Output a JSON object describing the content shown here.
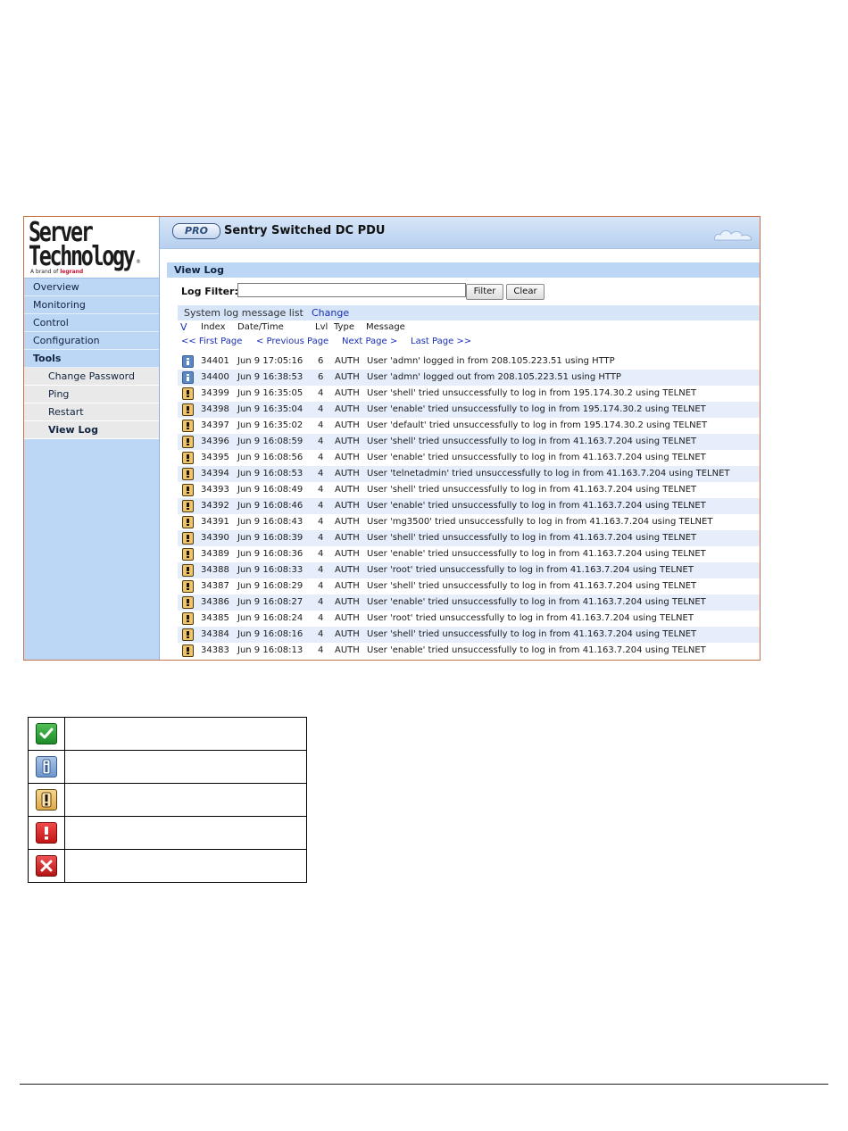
{
  "app": {
    "logo_line1": "Server",
    "logo_line2": "Technology",
    "logo_reg": "®",
    "brand_prefix": "A brand of",
    "brand_name": "legrand",
    "pro_badge": "PRO",
    "product_title": "Sentry Switched DC PDU"
  },
  "sidebar": {
    "items": [
      {
        "label": "Overview"
      },
      {
        "label": "Monitoring"
      },
      {
        "label": "Control"
      },
      {
        "label": "Configuration"
      },
      {
        "label": "Tools"
      }
    ],
    "tools_sub": [
      {
        "label": "Change Password"
      },
      {
        "label": "Ping"
      },
      {
        "label": "Restart"
      },
      {
        "label": "View Log"
      }
    ]
  },
  "section_title": "View Log",
  "filter": {
    "label": "Log Filter:",
    "value": "",
    "filter_button": "Filter",
    "clear_button": "Clear"
  },
  "list": {
    "title": "System log message list",
    "change_link": "Change",
    "sort_glyph": "V",
    "columns": {
      "index": "Index",
      "datetime": "Date/Time",
      "lvl": "Lvl",
      "type": "Type",
      "message": "Message"
    },
    "pager": {
      "first": "<< First Page",
      "prev": "< Previous Page",
      "next": "Next Page >",
      "last": "Last Page >>"
    },
    "rows": [
      {
        "icon": "info",
        "index": "34401",
        "datetime": "Jun 9 17:05:16",
        "lvl": "6",
        "type": "AUTH",
        "message": "User 'admn' logged in from 208.105.223.51 using HTTP"
      },
      {
        "icon": "info",
        "index": "34400",
        "datetime": "Jun 9 16:38:53",
        "lvl": "6",
        "type": "AUTH",
        "message": "User 'admn' logged out from 208.105.223.51 using HTTP"
      },
      {
        "icon": "warning",
        "index": "34399",
        "datetime": "Jun 9 16:35:05",
        "lvl": "4",
        "type": "AUTH",
        "message": "User 'shell' tried unsuccessfully to log in from 195.174.30.2 using TELNET"
      },
      {
        "icon": "warning",
        "index": "34398",
        "datetime": "Jun 9 16:35:04",
        "lvl": "4",
        "type": "AUTH",
        "message": "User 'enable' tried unsuccessfully to log in from 195.174.30.2 using TELNET"
      },
      {
        "icon": "warning",
        "index": "34397",
        "datetime": "Jun 9 16:35:02",
        "lvl": "4",
        "type": "AUTH",
        "message": "User 'default' tried unsuccessfully to log in from 195.174.30.2 using TELNET"
      },
      {
        "icon": "warning",
        "index": "34396",
        "datetime": "Jun 9 16:08:59",
        "lvl": "4",
        "type": "AUTH",
        "message": "User 'shell' tried unsuccessfully to log in from 41.163.7.204 using TELNET"
      },
      {
        "icon": "warning",
        "index": "34395",
        "datetime": "Jun 9 16:08:56",
        "lvl": "4",
        "type": "AUTH",
        "message": "User 'enable' tried unsuccessfully to log in from 41.163.7.204 using TELNET"
      },
      {
        "icon": "warning",
        "index": "34394",
        "datetime": "Jun 9 16:08:53",
        "lvl": "4",
        "type": "AUTH",
        "message": "User 'telnetadmin' tried unsuccessfully to log in from 41.163.7.204 using TELNET"
      },
      {
        "icon": "warning",
        "index": "34393",
        "datetime": "Jun 9 16:08:49",
        "lvl": "4",
        "type": "AUTH",
        "message": "User 'shell' tried unsuccessfully to log in from 41.163.7.204 using TELNET"
      },
      {
        "icon": "warning",
        "index": "34392",
        "datetime": "Jun 9 16:08:46",
        "lvl": "4",
        "type": "AUTH",
        "message": "User 'enable' tried unsuccessfully to log in from 41.163.7.204 using TELNET"
      },
      {
        "icon": "warning",
        "index": "34391",
        "datetime": "Jun 9 16:08:43",
        "lvl": "4",
        "type": "AUTH",
        "message": "User 'mg3500' tried unsuccessfully to log in from 41.163.7.204 using TELNET"
      },
      {
        "icon": "warning",
        "index": "34390",
        "datetime": "Jun 9 16:08:39",
        "lvl": "4",
        "type": "AUTH",
        "message": "User 'shell' tried unsuccessfully to log in from 41.163.7.204 using TELNET"
      },
      {
        "icon": "warning",
        "index": "34389",
        "datetime": "Jun 9 16:08:36",
        "lvl": "4",
        "type": "AUTH",
        "message": "User 'enable' tried unsuccessfully to log in from 41.163.7.204 using TELNET"
      },
      {
        "icon": "warning",
        "index": "34388",
        "datetime": "Jun 9 16:08:33",
        "lvl": "4",
        "type": "AUTH",
        "message": "User 'root' tried unsuccessfully to log in from 41.163.7.204 using TELNET"
      },
      {
        "icon": "warning",
        "index": "34387",
        "datetime": "Jun 9 16:08:29",
        "lvl": "4",
        "type": "AUTH",
        "message": "User 'shell' tried unsuccessfully to log in from 41.163.7.204 using TELNET"
      },
      {
        "icon": "warning",
        "index": "34386",
        "datetime": "Jun 9 16:08:27",
        "lvl": "4",
        "type": "AUTH",
        "message": "User 'enable' tried unsuccessfully to log in from 41.163.7.204 using TELNET"
      },
      {
        "icon": "warning",
        "index": "34385",
        "datetime": "Jun 9 16:08:24",
        "lvl": "4",
        "type": "AUTH",
        "message": "User 'root' tried unsuccessfully to log in from 41.163.7.204 using TELNET"
      },
      {
        "icon": "warning",
        "index": "34384",
        "datetime": "Jun 9 16:08:16",
        "lvl": "4",
        "type": "AUTH",
        "message": "User 'shell' tried unsuccessfully to log in from 41.163.7.204 using TELNET"
      },
      {
        "icon": "warning",
        "index": "34383",
        "datetime": "Jun 9 16:08:13",
        "lvl": "4",
        "type": "AUTH",
        "message": "User 'enable' tried unsuccessfully to log in from 41.163.7.204 using TELNET"
      }
    ]
  },
  "legend": {
    "entries": [
      {
        "icon": "ok-check-icon",
        "text": ""
      },
      {
        "icon": "info-icon",
        "text": ""
      },
      {
        "icon": "warning-icon",
        "text": ""
      },
      {
        "icon": "error-exclamation-icon",
        "text": ""
      },
      {
        "icon": "critical-x-icon",
        "text": ""
      }
    ]
  },
  "colors": {
    "sidebar_bg": "#bcd6f6",
    "header_bg": "#c8dcf4",
    "link": "#1a2fb4",
    "alt_row": "#e6eefb",
    "frame_border": "#c8744a"
  }
}
